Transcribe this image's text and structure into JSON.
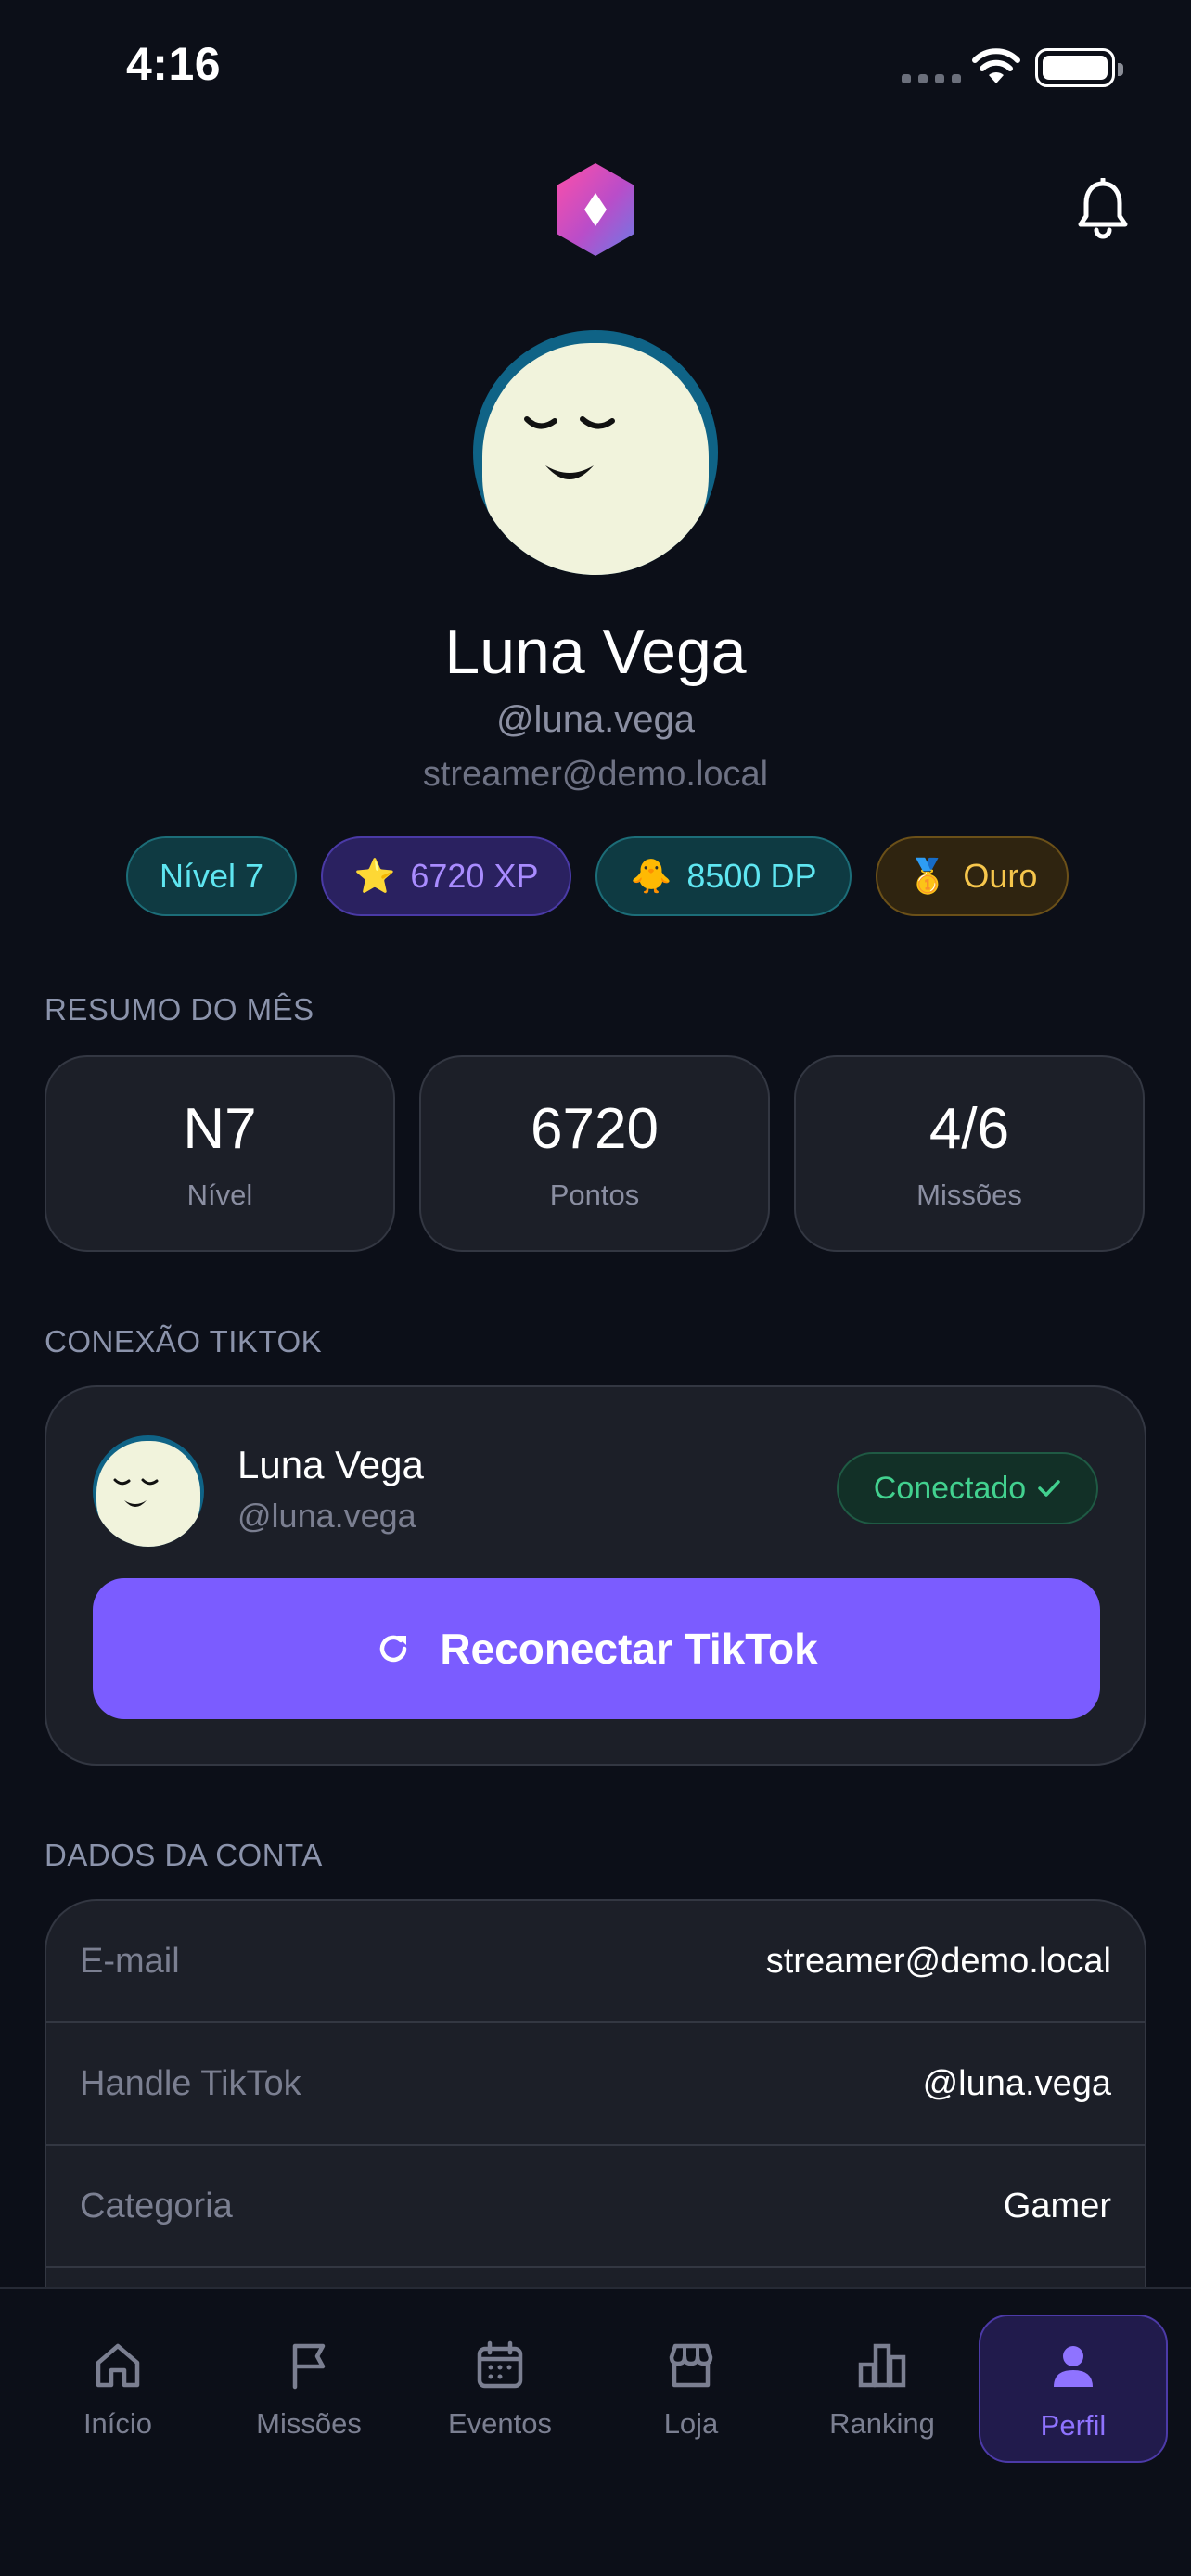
{
  "status_bar": {
    "time": "4:16"
  },
  "profile": {
    "name": "Luna Vega",
    "handle": "@luna.vega",
    "email": "streamer@demo.local"
  },
  "badges": {
    "level": "Nível 7",
    "xp": "6720 XP",
    "dp": "8500 DP",
    "tier": "Ouro",
    "xp_icon": "⭐",
    "dp_icon": "🐥",
    "tier_icon": "🥇"
  },
  "summary": {
    "section_label": "RESUMO DO MÊS",
    "cards": [
      {
        "value": "N7",
        "label": "Nível"
      },
      {
        "value": "6720",
        "label": "Pontos"
      },
      {
        "value": "4/6",
        "label": "Missões"
      }
    ]
  },
  "tiktok": {
    "section_label": "CONEXÃO TIKTOK",
    "name": "Luna Vega",
    "handle": "@luna.vega",
    "status": "Conectado",
    "reconnect_label": "Reconectar TikTok"
  },
  "account": {
    "section_label": "DADOS DA CONTA",
    "rows": [
      {
        "key": "E-mail",
        "value": "streamer@demo.local"
      },
      {
        "key": "Handle TikTok",
        "value": "@luna.vega"
      },
      {
        "key": "Categoria",
        "value": "Gamer"
      }
    ]
  },
  "tabs": [
    {
      "label": "Início",
      "icon": "home-icon"
    },
    {
      "label": "Missões",
      "icon": "flag-icon"
    },
    {
      "label": "Eventos",
      "icon": "calendar-icon"
    },
    {
      "label": "Loja",
      "icon": "store-icon"
    },
    {
      "label": "Ranking",
      "icon": "bar-chart-icon"
    },
    {
      "label": "Perfil",
      "icon": "user-icon",
      "active": true
    }
  ],
  "colors": {
    "background": "#0c0f18",
    "accent": "#7b5cff",
    "success": "#42d18f",
    "cyan": "#5fe6f1",
    "gold": "#f6c64c"
  }
}
